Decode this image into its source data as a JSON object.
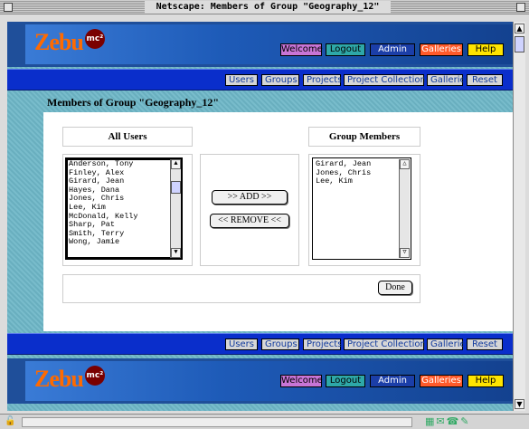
{
  "window": {
    "title": "Netscape: Members of Group \"Geography_12\""
  },
  "header": {
    "logo_text": "Zebu",
    "logo_badge": "mc²",
    "buttons": {
      "welcome": "Welcome",
      "logout": "Logout",
      "admin": "Admin",
      "galleries": "Galleries",
      "help": "Help"
    }
  },
  "nav": {
    "items": [
      "Users",
      "Groups",
      "Projects",
      "Project Collections",
      "Galleries",
      "Reset"
    ]
  },
  "page": {
    "title": "Members of Group \"Geography_12\"",
    "all_users_header": "All Users",
    "group_members_header": "Group Members",
    "all_users": [
      "Anderson, Tony",
      "Finley, Alex",
      "Girard, Jean",
      "Hayes, Dana",
      "Jones, Chris",
      "Lee, Kim",
      "McDonald, Kelly",
      "Sharp, Pat",
      "Smith, Terry",
      "Wong, Jamie"
    ],
    "group_members": [
      "Girard, Jean",
      "Jones, Chris",
      "Lee, Kim"
    ],
    "add_label": ">> ADD >>",
    "remove_label": "<< REMOVE <<",
    "done_label": "Done"
  },
  "colors": {
    "header_blue": "#1f4f9a",
    "nav_blue": "#0a2ecb",
    "background_teal": "#6db6c7",
    "logo_orange": "#ff6a00"
  }
}
